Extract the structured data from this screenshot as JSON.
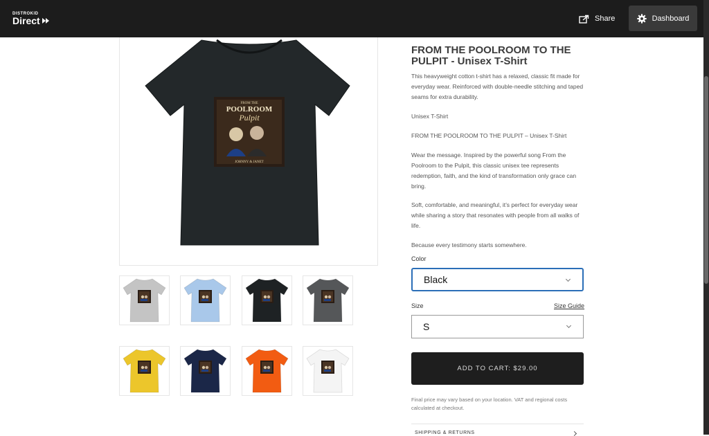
{
  "header": {
    "logo_top": "DISTROKID",
    "logo_main": "Direct",
    "share_label": "Share",
    "dashboard_label": "Dashboard"
  },
  "product": {
    "title": "FROM THE POOLROOM TO THE PULPIT - Unisex T-Shirt",
    "paragraphs": [
      "This heavyweight cotton t-shirt has a relaxed, classic fit made for everyday wear. Reinforced with double-needle stitching and taped seams for extra durability.",
      "Unisex T-Shirt",
      "FROM THE POOLROOM TO THE PULPIT – Unisex T-Shirt",
      "Wear the message. Inspired by the powerful song From the Poolroom to the Pulpit, this classic unisex tee represents redemption, faith, and the kind of transformation only grace can bring.",
      "Soft, comfortable, and meaningful, it’s perfect for everyday wear while sharing a story that resonates with people from all walks of life.",
      "Because every testimony starts somewhere."
    ],
    "artwork": {
      "line1": "FROM THE",
      "line2": "POOLROOM",
      "line3": "Pulpit",
      "artist": "JOHNNY & JANET"
    }
  },
  "options": {
    "color_label": "Color",
    "color_value": "Black",
    "size_label": "Size",
    "size_guide": "Size Guide",
    "size_value": "S"
  },
  "cart": {
    "button_label": "ADD TO CART: $29.00",
    "fine_print": "Final price may vary based on your location. VAT and regional costs calculated at checkout.",
    "shipping_label": "SHIPPING & RETURNS"
  },
  "swatches": [
    {
      "name": "grey",
      "color": "#c4c4c4"
    },
    {
      "name": "light-blue",
      "color": "#a9c8ea"
    },
    {
      "name": "black",
      "color": "#1e2224"
    },
    {
      "name": "charcoal",
      "color": "#555759"
    },
    {
      "name": "yellow",
      "color": "#ecc62b"
    },
    {
      "name": "navy",
      "color": "#1b2748"
    },
    {
      "name": "orange",
      "color": "#f25c12"
    },
    {
      "name": "white",
      "color": "#f4f4f4"
    }
  ],
  "colors": {
    "header_bg": "#1c1c1c",
    "accent_border": "#2a6eb7",
    "cart_bg": "#1e1e1e",
    "shirt_main": "#23282a"
  }
}
